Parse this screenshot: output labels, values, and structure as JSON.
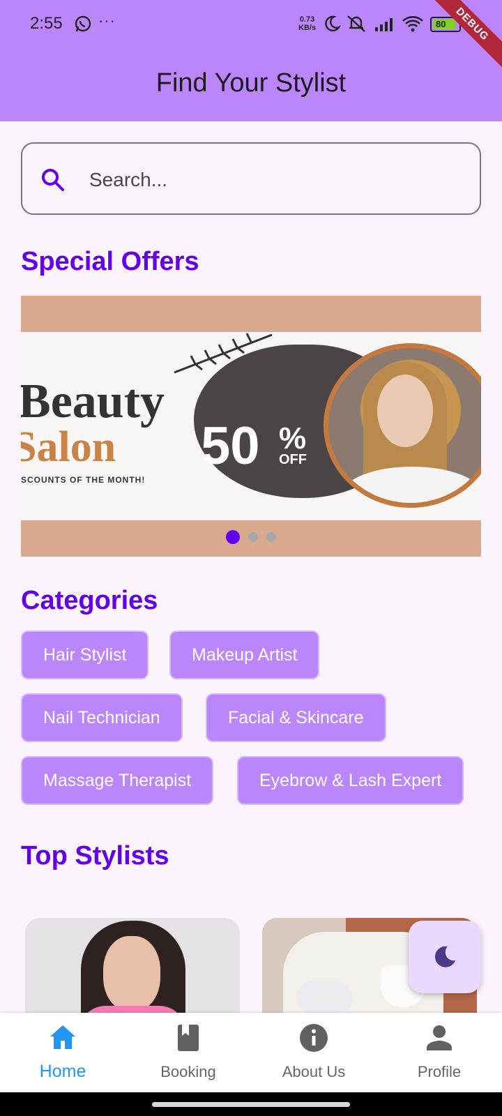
{
  "status_bar": {
    "time": "2:55",
    "more": "···",
    "net_speed_value": "0.73",
    "net_speed_unit": "KB/s",
    "battery_level": "80",
    "debug_label": "DEBUG"
  },
  "app_bar": {
    "title": "Find Your Stylist"
  },
  "search": {
    "placeholder": "Search..."
  },
  "special_offers": {
    "title": "Special Offers",
    "banner": {
      "line1": "Beauty",
      "line2": "Salon",
      "tagline": "SCOUNTS OF THE MONTH!",
      "discount": "50",
      "percent": "%",
      "off": "OFF"
    },
    "page_count": 3,
    "active_page": 1
  },
  "categories": {
    "title": "Categories",
    "items": [
      "Hair Stylist",
      "Makeup Artist",
      "Nail Technician",
      "Facial & Skincare",
      "Massage Therapist",
      "Eyebrow & Lash Expert"
    ]
  },
  "top_stylists": {
    "title": "Top Stylists"
  },
  "fab": {
    "icon": "moon-icon"
  },
  "bottom_nav": {
    "items": [
      {
        "label": "Home",
        "icon": "home-icon",
        "active": true
      },
      {
        "label": "Booking",
        "icon": "book-icon",
        "active": false
      },
      {
        "label": "About Us",
        "icon": "info-icon",
        "active": false
      },
      {
        "label": "Profile",
        "icon": "person-icon",
        "active": false
      }
    ]
  },
  "colors": {
    "app_bar": "#bb86fc",
    "accent": "#6200ea",
    "chip": "#bb86fc",
    "nav_active": "#2196f3",
    "background": "#fcf4fc"
  }
}
